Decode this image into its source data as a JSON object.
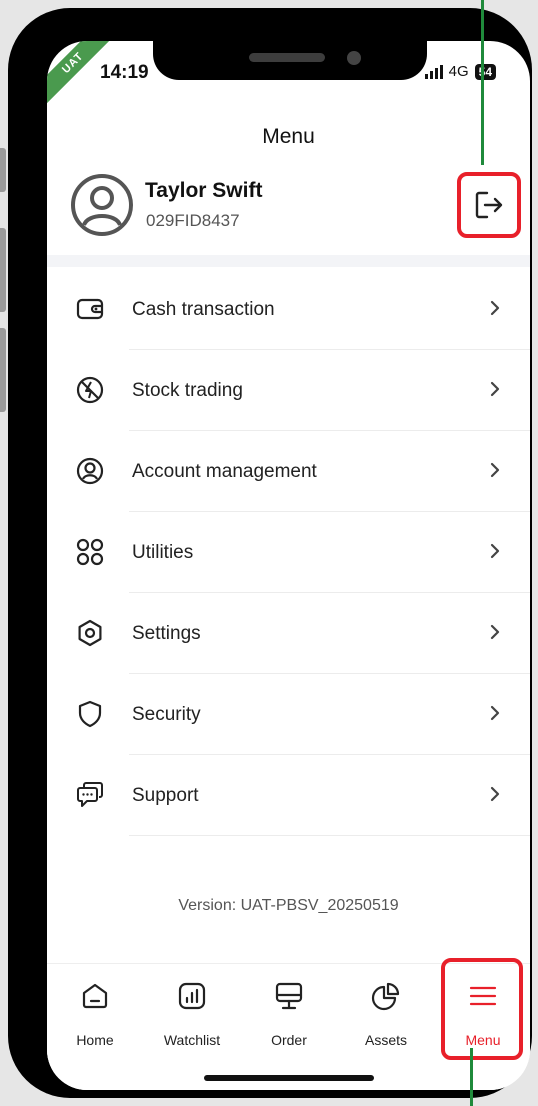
{
  "status_bar": {
    "time": "14:19",
    "network": "4G",
    "battery": "54",
    "env_badge": "UAT"
  },
  "header": {
    "title": "Menu"
  },
  "profile": {
    "name": "Taylor Swift",
    "account_id": "029FID8437"
  },
  "menu": {
    "items": [
      {
        "label": "Cash transaction",
        "icon": "wallet-icon"
      },
      {
        "label": "Stock trading",
        "icon": "stock-trading-icon"
      },
      {
        "label": "Account management",
        "icon": "user-circle-icon"
      },
      {
        "label": "Utilities",
        "icon": "grid-icon"
      },
      {
        "label": "Settings",
        "icon": "hexagon-settings-icon"
      },
      {
        "label": "Security",
        "icon": "shield-icon"
      },
      {
        "label": "Support",
        "icon": "chat-icon"
      }
    ]
  },
  "footer": {
    "version": "Version: UAT-PBSV_20250519"
  },
  "tabbar": {
    "tabs": [
      {
        "label": "Home",
        "icon": "home-icon"
      },
      {
        "label": "Watchlist",
        "icon": "watchlist-icon"
      },
      {
        "label": "Order",
        "icon": "monitor-icon"
      },
      {
        "label": "Assets",
        "icon": "pie-chart-icon"
      },
      {
        "label": "Menu",
        "icon": "hamburger-icon"
      }
    ],
    "active": "Menu"
  },
  "colors": {
    "accent": "#e8202a",
    "annotation_green": "#1f8a3b",
    "uat_badge": "#4a9a4e"
  }
}
